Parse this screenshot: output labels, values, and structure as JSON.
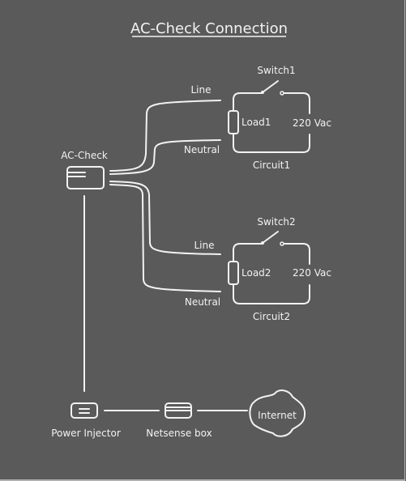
{
  "title": "AC-Check Connection",
  "colors": {
    "background": "#5a5a5a",
    "stroke": "#f2f2f2",
    "border": "#b0b0b0"
  },
  "devices": {
    "ac_check": {
      "label": "AC-Check",
      "icon": "device-card-icon"
    },
    "power_injector": {
      "label": "Power Injector",
      "icon": "power-injector-icon"
    },
    "netsense_box": {
      "label": "Netsense box",
      "icon": "network-box-icon"
    },
    "internet": {
      "label": "Internet",
      "icon": "cloud-icon"
    }
  },
  "circuits": [
    {
      "name": "Circuit1",
      "switch": "Switch1",
      "load": "Load1",
      "voltage": "220 Vac",
      "line_label": "Line",
      "neutral_label": "Neutral"
    },
    {
      "name": "Circuit2",
      "switch": "Switch2",
      "load": "Load2",
      "voltage": "220 Vac",
      "line_label": "Line",
      "neutral_label": "Neutral"
    }
  ]
}
